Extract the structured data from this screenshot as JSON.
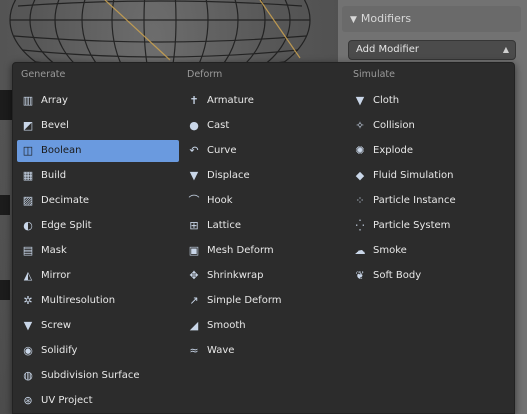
{
  "modifiers_panel": {
    "header": "Modifiers",
    "add_modifier": "Add Modifier"
  },
  "menu": {
    "columns": [
      {
        "heading": "Generate",
        "items": [
          {
            "label": "Array",
            "icon": "array-icon"
          },
          {
            "label": "Bevel",
            "icon": "bevel-icon"
          },
          {
            "label": "Boolean",
            "icon": "boolean-icon",
            "highlighted": true
          },
          {
            "label": "Build",
            "icon": "build-icon"
          },
          {
            "label": "Decimate",
            "icon": "decimate-icon"
          },
          {
            "label": "Edge Split",
            "icon": "edge-split-icon"
          },
          {
            "label": "Mask",
            "icon": "mask-icon"
          },
          {
            "label": "Mirror",
            "icon": "mirror-icon"
          },
          {
            "label": "Multiresolution",
            "icon": "multiresolution-icon"
          },
          {
            "label": "Screw",
            "icon": "screw-icon"
          },
          {
            "label": "Solidify",
            "icon": "solidify-icon"
          },
          {
            "label": "Subdivision Surface",
            "icon": "subdivision-surface-icon"
          },
          {
            "label": "UV Project",
            "icon": "uv-project-icon"
          }
        ]
      },
      {
        "heading": "Deform",
        "items": [
          {
            "label": "Armature",
            "icon": "armature-icon"
          },
          {
            "label": "Cast",
            "icon": "cast-icon"
          },
          {
            "label": "Curve",
            "icon": "curve-icon"
          },
          {
            "label": "Displace",
            "icon": "displace-icon"
          },
          {
            "label": "Hook",
            "icon": "hook-icon"
          },
          {
            "label": "Lattice",
            "icon": "lattice-icon"
          },
          {
            "label": "Mesh Deform",
            "icon": "mesh-deform-icon"
          },
          {
            "label": "Shrinkwrap",
            "icon": "shrinkwrap-icon"
          },
          {
            "label": "Simple Deform",
            "icon": "simple-deform-icon"
          },
          {
            "label": "Smooth",
            "icon": "smooth-icon"
          },
          {
            "label": "Wave",
            "icon": "wave-icon"
          }
        ]
      },
      {
        "heading": "Simulate",
        "items": [
          {
            "label": "Cloth",
            "icon": "cloth-icon"
          },
          {
            "label": "Collision",
            "icon": "collision-icon"
          },
          {
            "label": "Explode",
            "icon": "explode-icon"
          },
          {
            "label": "Fluid Simulation",
            "icon": "fluid-simulation-icon"
          },
          {
            "label": "Particle Instance",
            "icon": "particle-instance-icon"
          },
          {
            "label": "Particle System",
            "icon": "particle-system-icon"
          },
          {
            "label": "Smoke",
            "icon": "smoke-icon"
          },
          {
            "label": "Soft Body",
            "icon": "soft-body-icon"
          }
        ]
      }
    ]
  },
  "colors": {
    "highlight": "#6a9adf",
    "menu_bg": "#2c2c2c",
    "panel_bg": "#727272"
  }
}
